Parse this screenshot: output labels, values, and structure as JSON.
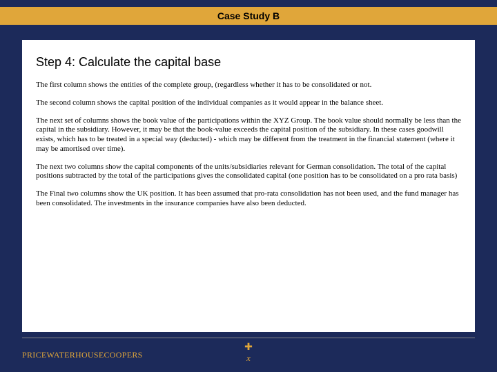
{
  "title": "Case Study B",
  "heading": "Step 4: Calculate the capital base",
  "paragraphs": [
    "The first column shows the entities of the complete group, (regardless whether it has to be consolidated or not.",
    "The second column shows the capital position of the individual companies as it would appear in the balance sheet.",
    "The next set of columns shows the book value of the participations within the XYZ Group. The book value should normally be less than the capital in the subsidiary. However, it may be that the book-value exceeds the capital position of the subsidiary. In these cases goodwill exists, which has to be treated in a special way (deducted) - which may be different from the treatment in the financial statement (where it may be amortised over time).",
    "The next two columns show the capital components of the units/subsidiaries relevant for German consolidation. The total of the capital positions subtracted by the total of the participations gives the consolidated capital (one position has to be consolidated on a pro rata basis)",
    "The Final two columns show the UK position.  It has been assumed that pro-rata consolidation has not been used, and the fund manager has been consolidated.  The investments in the insurance companies have also been deducted."
  ],
  "footer": {
    "brand": "PRICEWATERHOUSECOOPERS",
    "center_symbol": "✚",
    "center_mark": "x"
  }
}
